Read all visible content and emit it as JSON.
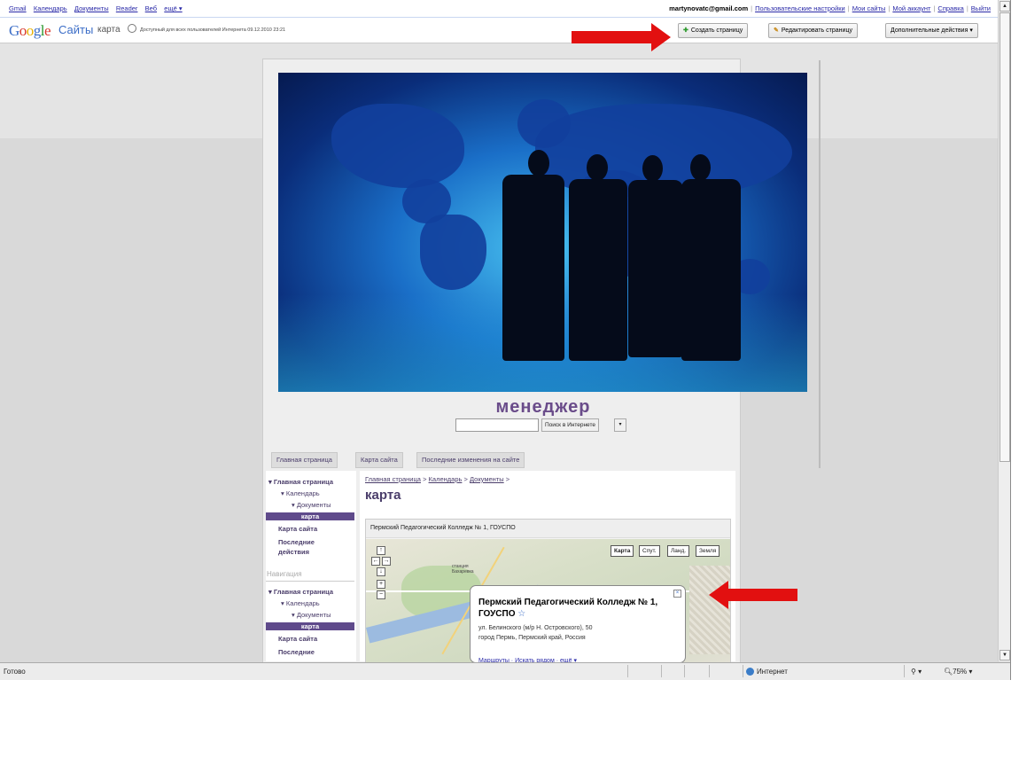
{
  "gbar": {
    "links": [
      "Gmail",
      "Календарь",
      "Документы",
      "Reader",
      "Веб",
      "ещё ▾"
    ],
    "email": "martynovatc@gmail.com",
    "right_links": [
      "Пользовательские настройки",
      "Мои сайты",
      "Мой аккаунт",
      "Справка",
      "Выйти"
    ]
  },
  "sites": {
    "logo_letters": [
      "G",
      "o",
      "o",
      "g",
      "l",
      "e"
    ],
    "logo_colors": [
      "#3b6dc7",
      "#d8372c",
      "#e6b000",
      "#3b6dc7",
      "#29962c",
      "#d8372c"
    ],
    "product": "Сайты",
    "page_name": "карта",
    "access_note": "Доступный для всех пользователей Интернета 09.12.2010 23:21",
    "buttons": {
      "create": "Создать страницу",
      "edit": "Редактировать страницу",
      "more": "Дополнительные действия ▾"
    }
  },
  "site": {
    "title": "менеджер",
    "search_button": "Поиск в Интернете",
    "search_dropdown": "▾",
    "tabs": [
      "Главная страница",
      "Карта сайта",
      "Последние изменения на сайте"
    ],
    "sidebar1": {
      "home": "▾ Главная страница",
      "calendar": "▾ Календарь",
      "docs": "▾ Документы",
      "map": "карта",
      "sitemap": "Карта сайта",
      "recent": "Последние",
      "recent2": "действия"
    },
    "nav_heading": "Навигация",
    "sidebar2": {
      "home": "▾ Главная страница",
      "calendar": "▾ Календарь",
      "docs": "▾ Документы",
      "map": "карта",
      "sitemap": "Карта сайта",
      "recent": "Последние"
    },
    "breadcrumb": [
      "Главная страница",
      "Календарь",
      "Документы"
    ],
    "breadcrumb_sep": ">",
    "page_title": "карта",
    "map": {
      "header": "Пермский Педагогический Колледж № 1, ГОУСПО",
      "types": [
        "Карта",
        "Спут.",
        "Ланд.",
        "Земля"
      ],
      "station_label": "станция Бахаревка",
      "info_title": "Пермский Педагогический Колледж № 1, ГОУСПО",
      "info_star": "☆",
      "info_address1": "ул. Белинского (м/р Н. Островского), 50",
      "info_address2": "город Пермь, Пермский край, Россия",
      "info_links": "Маршруты · Искать рядом · ещё ▾",
      "close": "×"
    }
  },
  "status": {
    "ready": "Готово",
    "zone": "Интернет",
    "zoom": "75%"
  },
  "colors": {
    "arrow": "#e21010",
    "site_purple": "#4a3d6a",
    "selected": "#5f4a8b"
  }
}
